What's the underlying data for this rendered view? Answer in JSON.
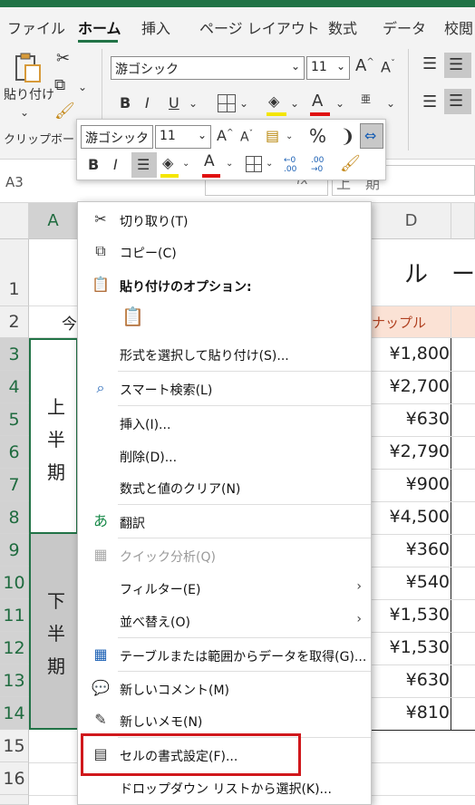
{
  "colors": {
    "accent": "#217346",
    "highlight_box": "#d0181c"
  },
  "ribbon_tabs": [
    "ファイル",
    "ホーム",
    "挿入",
    "ページ レイアウト",
    "数式",
    "データ",
    "校閲"
  ],
  "ribbon": {
    "paste_label": "貼り付け",
    "clipboard_group": "クリップボード",
    "font_name": "游ゴシック",
    "font_size": "11",
    "bold": "B",
    "italic": "I",
    "underline": "U",
    "increase_font": "A^",
    "decrease_font": "Aˇ",
    "font_color_letter": "A"
  },
  "minibar": {
    "font_name": "游ゴシック",
    "font_size": "11",
    "percent": "%",
    "comma": "❩",
    "bold": "B",
    "italic": "I",
    "font_color_letter": "A",
    "inc_decimal": "←0 .00",
    "dec_decimal": ".00 →0"
  },
  "formula_bar": {
    "name_box": "A3",
    "fx": "fx"
  },
  "sheet": {
    "col_headers": [
      "A",
      "D"
    ],
    "row_numbers": [
      "1",
      "2",
      "3",
      "4",
      "5",
      "6",
      "7",
      "8",
      "9",
      "10",
      "11",
      "12",
      "13",
      "14",
      "15",
      "16"
    ],
    "title_partial": "ル　ー",
    "a2_partial": "今",
    "d2_header": "ナップル",
    "formula_partial": "上　期",
    "upper_half": [
      "上",
      "半",
      "期"
    ],
    "lower_half": [
      "下",
      "半",
      "期"
    ],
    "prices": [
      "¥1,800",
      "¥2,700",
      "¥630",
      "¥2,790",
      "¥900",
      "¥4,500",
      "¥360",
      "¥540",
      "¥1,530",
      "¥1,530",
      "¥630",
      "¥810"
    ]
  },
  "context_menu": {
    "cut": "切り取り(T)",
    "copy": "コピー(C)",
    "paste_options": "貼り付けのオプション:",
    "paste_special": "形式を選択して貼り付け(S)...",
    "smart_lookup": "スマート検索(L)",
    "insert": "挿入(I)...",
    "delete": "削除(D)...",
    "clear_contents": "数式と値のクリア(N)",
    "translate": "翻訳",
    "quick_analysis": "クイック分析(Q)",
    "filter": "フィルター(E)",
    "sort": "並べ替え(O)",
    "get_data": "テーブルまたは範囲からデータを取得(G)...",
    "new_comment": "新しいコメント(M)",
    "new_note": "新しいメモ(N)",
    "format_cells": "セルの書式設定(F)...",
    "pick_from_list": "ドロップダウン リストから選択(K)..."
  }
}
